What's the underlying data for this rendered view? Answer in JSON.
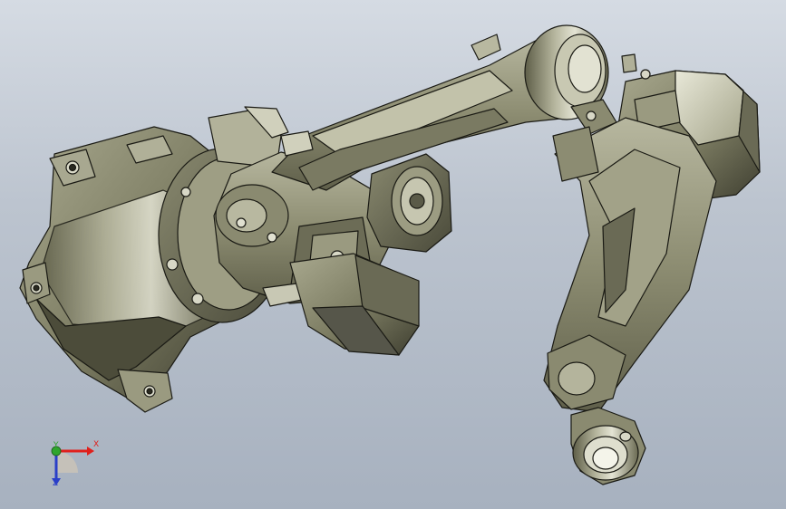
{
  "viewport": {
    "background_top": "#d5dbe3",
    "background_bottom": "#a7b1bf"
  },
  "model": {
    "description_icon": "robot-arm-3d-model",
    "body_color": "#86866c",
    "edge_color": "#1a1a14",
    "highlight_color": "#d8d8c4"
  },
  "triad": {
    "x_label": "X",
    "y_label": "Y",
    "z_label": "Z",
    "x_color": "#e0201c",
    "y_color": "#2fa52c",
    "z_color": "#2a3fc8"
  }
}
